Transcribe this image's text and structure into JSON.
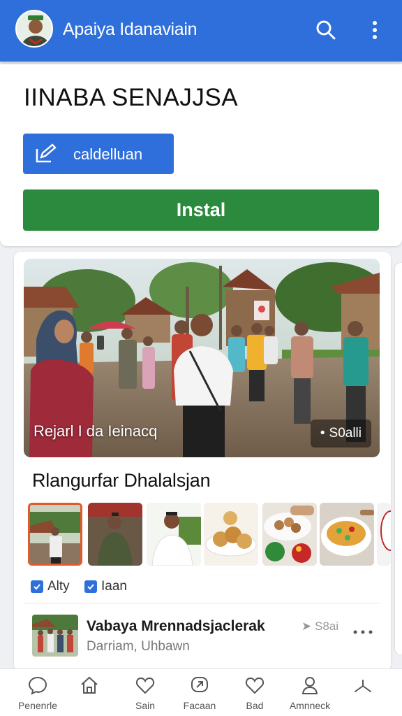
{
  "header": {
    "title": "Apaiya Idanaviain",
    "icons": [
      "avatar",
      "search-icon",
      "more-vert-icon"
    ]
  },
  "card": {
    "title": "IINABA SENAJJSA",
    "edit_button_label": "caldelluan",
    "install_button_label": "Instal"
  },
  "hero": {
    "caption": "Rejarl I da Ieinacq",
    "badge": "S0alli"
  },
  "section": {
    "title": "Rlangurfar Dhalalsjan"
  },
  "thumbnails": [
    {
      "kind": "village-street",
      "selected": true
    },
    {
      "kind": "man-shirt",
      "selected": false
    },
    {
      "kind": "man-white",
      "selected": false
    },
    {
      "kind": "bread-plate",
      "selected": false
    },
    {
      "kind": "food-bowl",
      "selected": false
    },
    {
      "kind": "stir-fry",
      "selected": false
    }
  ],
  "tags": [
    {
      "label": "Alty"
    },
    {
      "label": "Iaan"
    }
  ],
  "post": {
    "title": "Vabaya Mrennadsjaclerak",
    "meta": "S8ai",
    "subtitle": "Darriam, Uhbawn"
  },
  "bottom_nav": [
    {
      "label": "Penenrle",
      "icon": "chat-icon"
    },
    {
      "label": "",
      "icon": "home-icon"
    },
    {
      "label": "Sain",
      "icon": "heart-icon"
    },
    {
      "label": "Facaan",
      "icon": "message-icon"
    },
    {
      "label": "Bad",
      "icon": "heart-icon"
    },
    {
      "label": "Amnneck",
      "icon": "person-icon"
    },
    {
      "label": "",
      "icon": "share-icon"
    }
  ],
  "colors": {
    "primary": "#2f6fdc",
    "install": "#2b8a3e",
    "selected_border": "#e05a2c"
  }
}
